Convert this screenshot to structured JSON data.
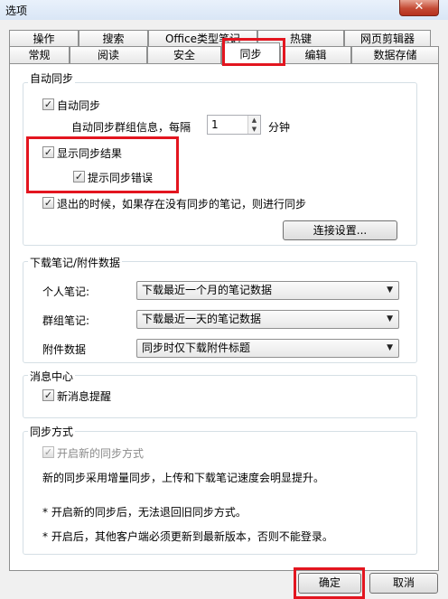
{
  "window": {
    "title": "选项",
    "close_glyph": "✕"
  },
  "tabs_row1": [
    "操作",
    "搜索",
    "Office类型笔记",
    "热键",
    "网页剪辑器"
  ],
  "tabs_row2": [
    "常规",
    "阅读",
    "安全",
    "同步",
    "编辑",
    "数据存储"
  ],
  "active_tab": "同步",
  "auto_sync": {
    "title": "自动同步",
    "enable_label": "自动同步",
    "enable_checked": true,
    "interval_label": "自动同步群组信息，每隔",
    "interval_value": "1",
    "interval_unit": "分钟",
    "show_result_label": "显示同步结果",
    "show_result_checked": true,
    "show_errors_label": "提示同步错误",
    "show_errors_checked": true,
    "sync_on_exit_label": "退出的时候，如果存在没有同步的笔记，则进行同步",
    "sync_on_exit_checked": true,
    "connection_button": "连接设置..."
  },
  "download": {
    "title": "下载笔记/附件数据",
    "personal_label": "个人笔记:",
    "personal_value": "下载最近一个月的笔记数据",
    "group_label": "群组笔记:",
    "group_value": "下载最近一天的笔记数据",
    "attachment_label": "附件数据",
    "attachment_value": "同步时仅下载附件标题"
  },
  "messages": {
    "title": "消息中心",
    "new_message_label": "新消息提醒",
    "new_message_checked": true
  },
  "sync_mode": {
    "title": "同步方式",
    "enable_new_label": "开启新的同步方式",
    "enable_new_checked": true,
    "desc": "新的同步采用增量同步，上传和下载笔记速度会明显提升。",
    "note1": "* 开启新的同步后，无法退回旧同步方式。",
    "note2": "* 开启后，其他客户端必须更新到最新版本，否则不能登录。"
  },
  "footer": {
    "ok": "确定",
    "cancel": "取消"
  },
  "icons": {
    "check": "✓",
    "arrow_down": "▼",
    "spin_up": "▲",
    "spin_down": "▼"
  }
}
